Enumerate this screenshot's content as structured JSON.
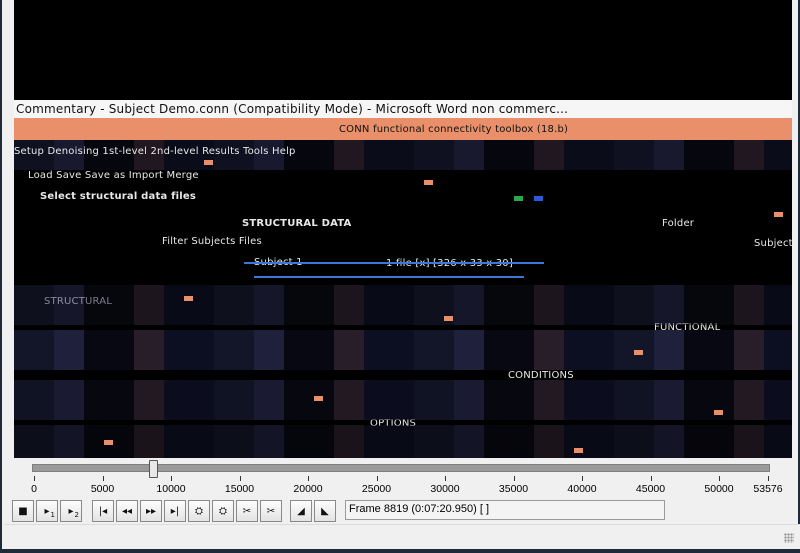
{
  "video": {
    "glitch_title": "Commentary - Subject Demo.conn (Compatibility Mode) - Microsoft Word non commerc...",
    "glitch_subtitle": "CONN functional connectivity toolbox (18.b)",
    "glitch_texts": [
      "Setup  Denoising  1st-level  2nd-level  Results  Tools  Help",
      "Load  Save  Save as  Import  Merge",
      "Select structural data files",
      "STRUCTURAL DATA",
      "Filter   Subjects   Files",
      "Subject 1",
      "1 file [x] [326 x 33 x 30]",
      "STRUCTURAL",
      "FUNCTIONAL",
      "CONDITIONS",
      "OPTIONS",
      "Folder",
      "Subjects"
    ]
  },
  "timeline": {
    "value": 8819,
    "max": 53576,
    "tick_labels": [
      "0",
      "5000",
      "10000",
      "15000",
      "20000",
      "25000",
      "30000",
      "35000",
      "40000",
      "45000",
      "50000",
      "53576"
    ]
  },
  "toolbar": {
    "buttons": [
      {
        "name": "stop-button",
        "glyph": "■",
        "sub": ""
      },
      {
        "name": "step-back-button",
        "glyph": "▸",
        "sub": "1"
      },
      {
        "name": "step-forward-button",
        "glyph": "▸",
        "sub": "2"
      },
      {
        "name": "go-start-button",
        "glyph": "|◂",
        "sub": ""
      },
      {
        "name": "rewind-button",
        "glyph": "◂◂",
        "sub": ""
      },
      {
        "name": "fast-forward-button",
        "glyph": "▸▸",
        "sub": ""
      },
      {
        "name": "go-end-button",
        "glyph": "▸|",
        "sub": ""
      },
      {
        "name": "mark-in-button",
        "glyph": "⛭",
        "sub": ""
      },
      {
        "name": "mark-out-button",
        "glyph": "⛭",
        "sub": ""
      },
      {
        "name": "cut-button",
        "glyph": "✂",
        "sub": ""
      },
      {
        "name": "export-button",
        "glyph": "✂",
        "sub": ""
      },
      {
        "name": "prev-keyframe-button",
        "glyph": "◢",
        "sub": ""
      },
      {
        "name": "next-keyframe-button",
        "glyph": "◣",
        "sub": ""
      }
    ]
  },
  "frame_readout": "Frame 8819 (0:07:20.950) [ ]",
  "colors": {
    "accent_orange": "#e9906a",
    "window_border": "#1e2b39"
  }
}
